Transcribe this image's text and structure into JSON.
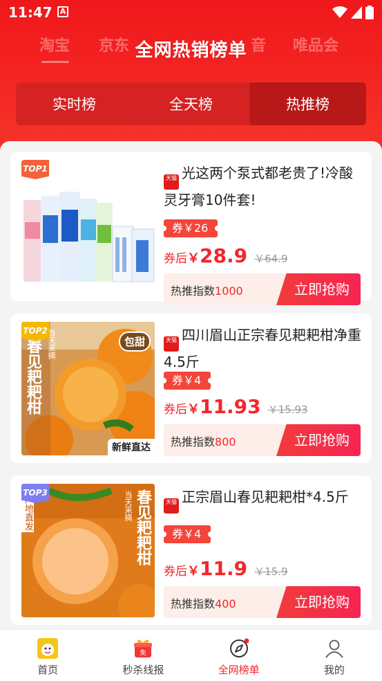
{
  "status": {
    "time": "11:47",
    "badge": "A"
  },
  "header": {
    "title": "全网热销榜单",
    "bg_tabs": [
      "淘宝",
      "京东",
      "音",
      "唯品会"
    ]
  },
  "segments": [
    {
      "label": "实时榜",
      "active": false
    },
    {
      "label": "全天榜",
      "active": false
    },
    {
      "label": "热推榜",
      "active": true
    }
  ],
  "products": [
    {
      "rank": "TOP1",
      "rank_color": "#f4623a",
      "shop_badge": "天猫",
      "title": "光这两个泵式都老贵了!冷酸灵牙膏10件套!",
      "coupon": "券￥26",
      "price_label": "券后",
      "price_yen": "￥",
      "price": "28.9",
      "original_price": "￥64.9",
      "hot_label": "热推指数",
      "hot_value": "1000",
      "buy_label": "立即抢购"
    },
    {
      "rank": "TOP2",
      "rank_color": "#f5b800",
      "shop_badge": "天猫",
      "title": "四川眉山正宗春见耙耙柑净重4.5斤",
      "coupon": "券￥4",
      "price_label": "券后",
      "price_yen": "￥",
      "price": "11.93",
      "original_price": "￥15.93",
      "hot_label": "热推指数",
      "hot_value": "800",
      "buy_label": "立即抢购",
      "image_text": {
        "vertical": "春见耙耙柑",
        "small": "当天采摘",
        "bubble": "包甜",
        "bottom": "新鲜直达"
      }
    },
    {
      "rank": "TOP3",
      "rank_color": "#7e7ef0",
      "shop_badge": "天猫",
      "title": "正宗眉山春见耙耙柑*4.5斤",
      "coupon": "券￥4",
      "price_label": "券后",
      "price_yen": "￥",
      "price": "11.9",
      "original_price": "￥15.9",
      "hot_label": "热推指数",
      "hot_value": "400",
      "buy_label": "立即抢购",
      "image_text": {
        "vertical": "春见耙耙柑",
        "small": "当天采摘",
        "side": "产地直发"
      }
    }
  ],
  "tabbar": [
    {
      "label": "首页",
      "icon": "home-cat-icon",
      "active": false
    },
    {
      "label": "秒杀线报",
      "icon": "gift-icon",
      "active": false
    },
    {
      "label": "全网榜单",
      "icon": "compass-icon",
      "active": true
    },
    {
      "label": "我的",
      "icon": "user-icon",
      "active": false
    }
  ],
  "colors": {
    "brand_red": "#f3262b",
    "header_red": "#f0171b"
  }
}
